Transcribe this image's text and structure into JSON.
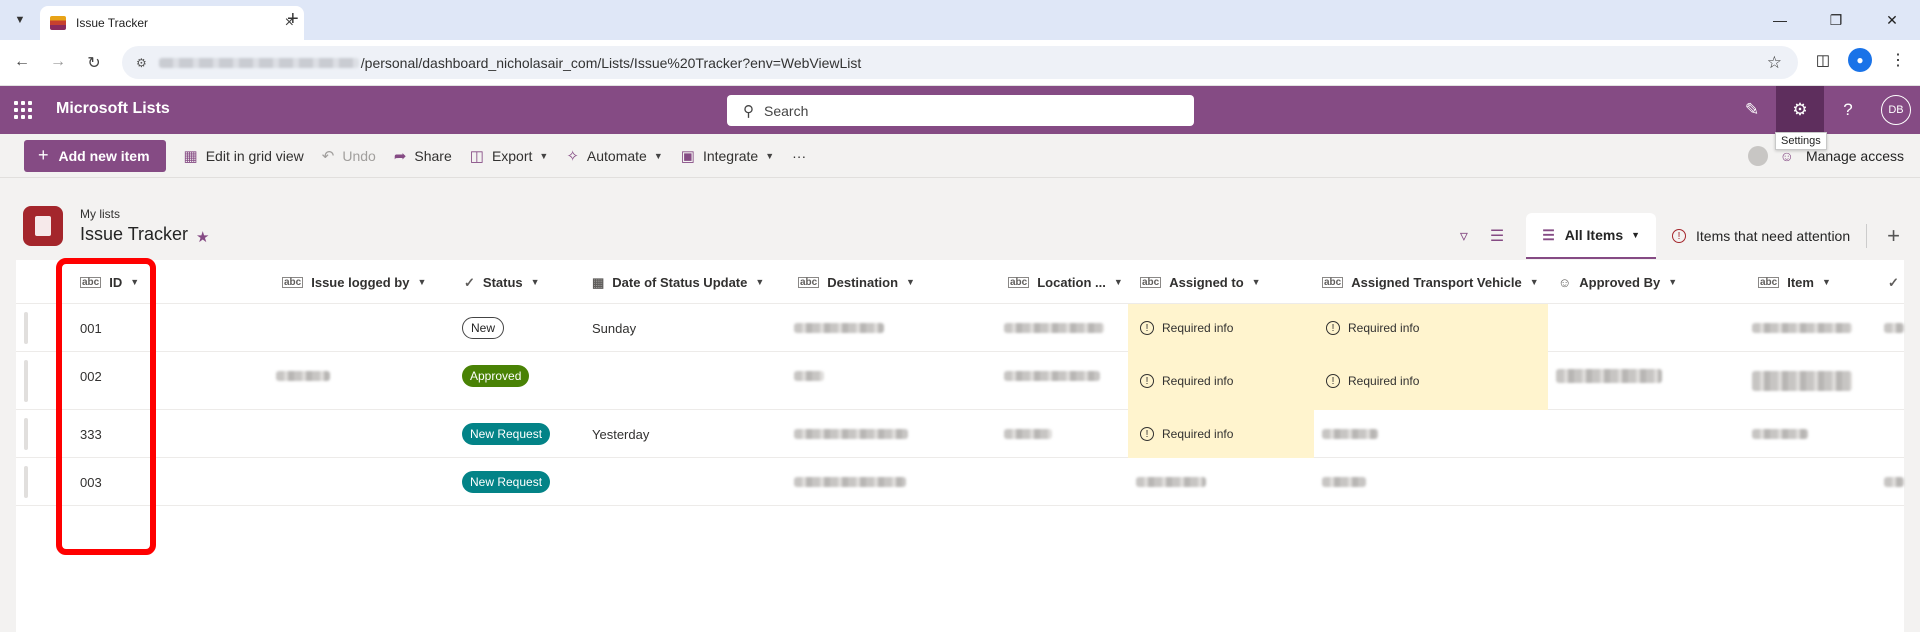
{
  "browser": {
    "tab_title": "Issue Tracker",
    "url_visible": "/personal/dashboard_nicholasair_com/Lists/Issue%20Tracker?env=WebViewList"
  },
  "suitebar": {
    "app_name": "Microsoft Lists",
    "search_placeholder": "Search",
    "avatar_initials": "DB",
    "settings_tooltip": "Settings"
  },
  "commandbar": {
    "add_new_item": "Add new item",
    "edit_grid": "Edit in grid view",
    "undo": "Undo",
    "share": "Share",
    "export": "Export",
    "automate": "Automate",
    "integrate": "Integrate",
    "more": "···",
    "manage_access": "Manage access"
  },
  "list": {
    "breadcrumb": "My lists",
    "title": "Issue Tracker",
    "views": {
      "all_items": "All Items",
      "attention": "Items that need attention"
    }
  },
  "columns": {
    "id": "ID",
    "issue_logged_by": "Issue logged by",
    "status": "Status",
    "date_of_status_update": "Date of Status Update",
    "destination": "Destination",
    "location": "Location ...",
    "assigned_to": "Assigned to",
    "assigned_transport_vehicle": "Assigned Transport Vehicle",
    "approved_by": "Approved By",
    "item": "Item"
  },
  "rows": [
    {
      "id": "001",
      "status": "New",
      "date": "Sunday",
      "assigned_to": "Required info",
      "vehicle": "Required info"
    },
    {
      "id": "002",
      "status": "Approved",
      "date": "",
      "assigned_to": "Required info",
      "vehicle": "Required info"
    },
    {
      "id": "333",
      "status": "New Request",
      "date": "Yesterday",
      "assigned_to": "Required info",
      "vehicle": ""
    },
    {
      "id": "003",
      "status": "New Request",
      "date": "",
      "assigned_to": "",
      "vehicle": ""
    }
  ],
  "colors": {
    "brand": "#854b84",
    "approved": "#498205",
    "new_request": "#038387",
    "required_info_bg": "#fff4ce",
    "annotation": "#ff0000"
  }
}
